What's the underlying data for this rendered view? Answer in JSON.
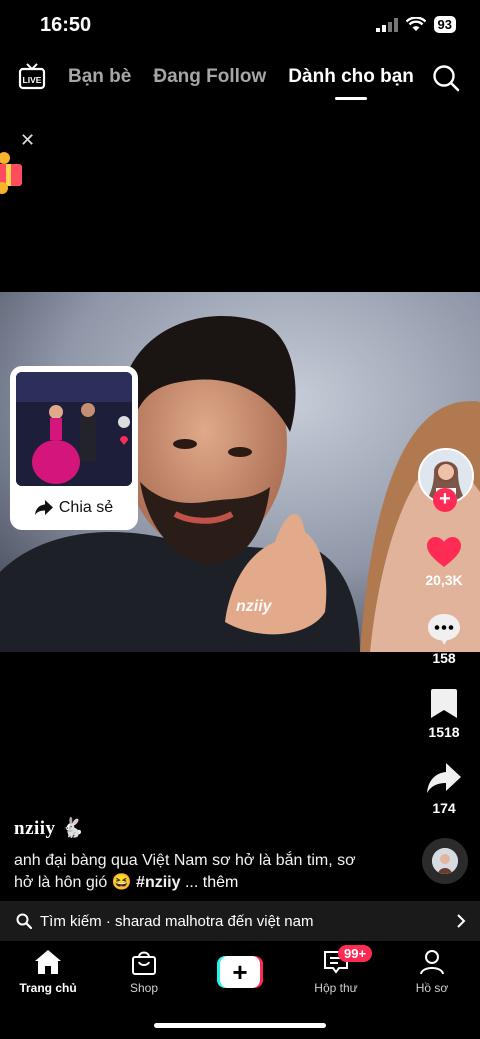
{
  "status_bar": {
    "time": "16:50",
    "battery": "93"
  },
  "top_nav": {
    "live_label": "LIVE",
    "tabs": [
      {
        "label": "Bạn bè",
        "active": false
      },
      {
        "label": "Đang Follow",
        "active": false
      },
      {
        "label": "Dành cho bạn",
        "active": true
      }
    ]
  },
  "video": {
    "watermark": "nziiy"
  },
  "share_card": {
    "label": "Chia sẻ"
  },
  "rail": {
    "likes": "20,3K",
    "comments": "158",
    "saves": "1518",
    "shares": "174"
  },
  "post": {
    "username": "nziiy 🐇",
    "caption": "anh đại bàng qua Việt Nam sơ hở là bắn tim, sơ hở là hôn gió 😆 ",
    "hashtag": "#nziiy",
    "more": " ... thêm"
  },
  "search_suggestion": {
    "prefix": "Tìm kiếm · ",
    "query": "sharad malhotra đến việt nam"
  },
  "bottom_nav": {
    "home": "Trang chủ",
    "shop": "Shop",
    "create": "+",
    "inbox": "Hộp thư",
    "inbox_badge": "99+",
    "profile": "Hồ sơ"
  },
  "colors": {
    "accent": "#fe2c55",
    "cyan": "#25f4ee"
  }
}
